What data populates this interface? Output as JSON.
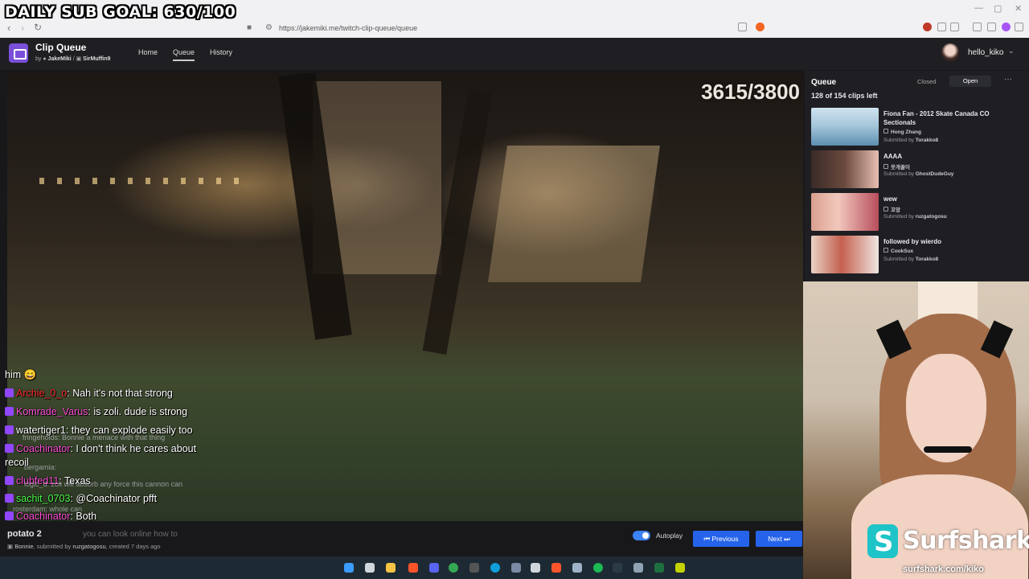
{
  "overlay": {
    "sub_goal": "DAILY SUB GOAL: 630/100"
  },
  "browser": {
    "url": "https://jakemiki.me/twitch-clip-queue/queue"
  },
  "app": {
    "title": "Clip Queue",
    "by_prefix": "by",
    "author1": "JakeMiki",
    "separator": "/",
    "author2": "SirMuffin9",
    "nav": [
      {
        "label": "Home",
        "active": false
      },
      {
        "label": "Queue",
        "active": true
      },
      {
        "label": "History",
        "active": false
      }
    ],
    "username": "hello_kiko"
  },
  "player": {
    "counter": "3615/3800"
  },
  "chat": [
    {
      "user": "Archie_0_o",
      "color": "#ff2d2d",
      "text": "Nah it's not that strong"
    },
    {
      "user": "Komrade_Varus",
      "color": "#ff4fd8",
      "text": "is zoli. dude is strong"
    },
    {
      "user": "watertiger1",
      "color": "#ffffff",
      "text": "they can explode easily too"
    },
    {
      "user": "Coachinator",
      "color": "#ff4fd8",
      "text": "I don't think he cares about"
    },
    {
      "user": "clubfed11",
      "color": "#ff4fd8",
      "text": "Texas"
    },
    {
      "user": "sachit_0703",
      "color": "#4cff4c",
      "text": "@Coachinator pfft"
    },
    {
      "user": "Coachinator",
      "color": "#ff4fd8",
      "text": "Both"
    }
  ],
  "chat_extra": {
    "him": "him",
    "recoil": "recoil"
  },
  "chat_ghost": [
    "fringeholds: Bonnie a menace with that thing",
    "bergamia:",
    "logic_d: zoli will absorb any force this cannon can",
    "rosterdam: whole can"
  ],
  "clip": {
    "title": "potato 2",
    "channel": "Bonnie",
    "submitted_prefix": ", submitted by",
    "submitter": "ruzgatogosu",
    "created": ", created 7 days ago",
    "ghost_text": "you can look online how to"
  },
  "controls": {
    "autoplay_label": "Autoplay",
    "autoplay_on": true,
    "previous_label": "Previous",
    "next_label": "Next"
  },
  "queue": {
    "title": "Queue",
    "count": "128 of 154 clips left",
    "closed_label": "Closed",
    "open_label": "Open",
    "more": "···",
    "items": [
      {
        "title": "Fiona Fan - 2012 Skate Canada CO Sectionals",
        "channel": "Hong Zhang",
        "submitted": "Submitted by",
        "submitter": "Torakko8"
      },
      {
        "title": "AAAA",
        "channel": "웃개꿀이",
        "submitted": "Submitted by",
        "submitter": "GhostDudeGuy"
      },
      {
        "title": "wew",
        "channel": "꼬앙",
        "submitted": "Submitted by",
        "submitter": "ruzgatogosu"
      },
      {
        "title": "followed by wierdo",
        "channel": "CookSux",
        "submitted": "Submitted by",
        "submitter": "Torakko8"
      }
    ]
  },
  "sponsor": {
    "name": "Surfshark",
    "reg": "®",
    "url": "surfshark.com/kiko"
  }
}
